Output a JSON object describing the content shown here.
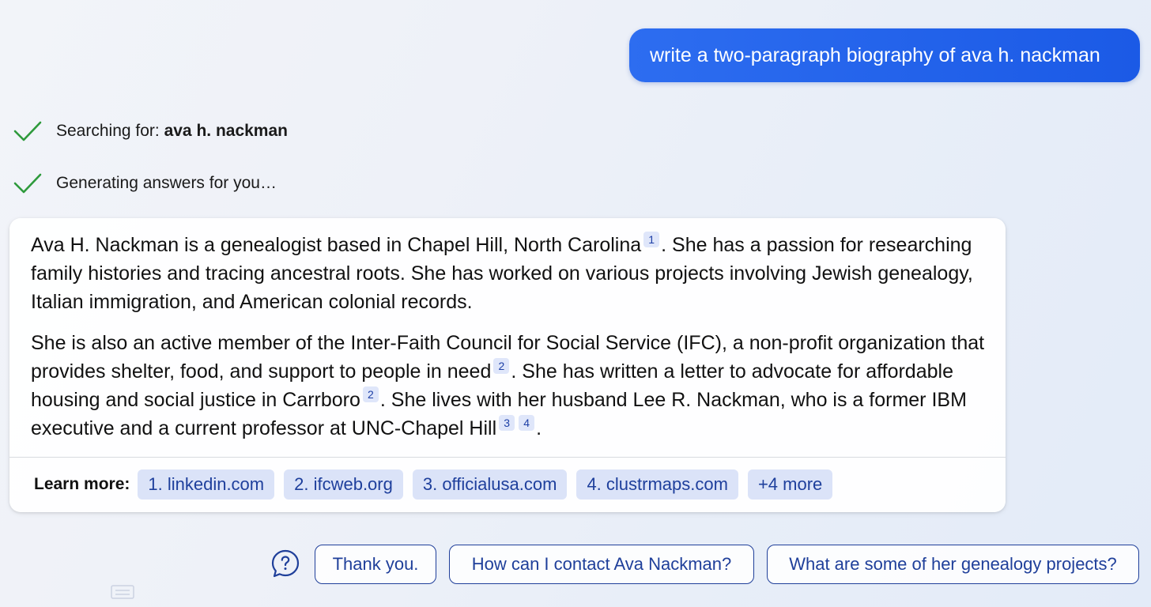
{
  "user_message": "write a two-paragraph biography of ava h. nackman",
  "status": [
    {
      "icon": "check-icon",
      "prefix": "Searching for: ",
      "bold": "ava h. nackman"
    },
    {
      "icon": "check-icon",
      "prefix": "Generating answers for you…",
      "bold": ""
    }
  ],
  "answer": {
    "p1": {
      "t1": "Ava H. Nackman is a genealogist based in Chapel Hill, North Carolina",
      "c1": "1",
      "t2": ". She has a passion for researching family histories and tracing ancestral roots. She has worked on various projects involving Jewish genealogy, Italian immigration, and American colonial records."
    },
    "p2": {
      "t1": "She is also an active member of the Inter-Faith Council for Social Service (IFC), a non-profit organization that provides shelter, food, and support to people in need",
      "c1": "2",
      "t2": ". She has written a letter to advocate for affordable housing and social justice in Carrboro",
      "c2": "2",
      "t3": ". She lives with her husband Lee R. Nackman, who is a former IBM executive and a current professor at UNC-Chapel Hill",
      "c3": "3",
      "c4": "4",
      "t4": "."
    }
  },
  "learn_more": {
    "label": "Learn more:",
    "sources": [
      "1. linkedin.com",
      "2. ifcweb.org",
      "3. officialusa.com",
      "4. clustrmaps.com",
      "+4 more"
    ]
  },
  "suggestions": [
    "Thank you.",
    "How can I contact Ava Nackman?",
    "What are some of her genealogy projects?"
  ],
  "colors": {
    "user_bubble": "#1b5ae6",
    "check": "#2e9a3c",
    "citation_bg": "#dfe6fa",
    "link_text": "#1e3f9c"
  }
}
